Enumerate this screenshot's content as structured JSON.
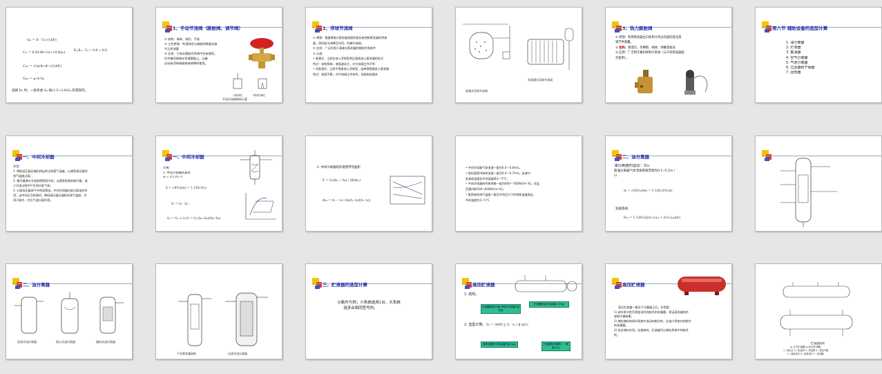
{
  "slides": [
    {
      "id": 1,
      "formulas": [
        "G₀ = d · C₀·√(ΔP)",
        "C₀ = 0.0148·√(v₁+0.6γ₂)",
        "K₁,K₂ : C₀ = 0.6 ~ 0.8",
        "C₀₂ = √(π/4)·d²·√(2ΔP)",
        "G₀₀ = μ·A·G₀"
      ],
      "note": "选择 D₀ 时，一般考虑 G₀ 按(1.5~2.0)G₀ 的范围内。"
    },
    {
      "id": 2,
      "title": "1、手动节流阀（膨胀阀、调节阀）",
      "lines": [
        "① 结构：阀体、阀芯、手轮",
        "② 工作原理：利用阀芯与阀座间隙变化调",
        "   节工质流量",
        "③ 应用：只有在氨制冷系统中仍有使用，",
        "   作为备用阀装在旁通管路上，以备",
        "   自动或浮球阀维修或故障时使用。"
      ],
      "caption": "手动节流阀结构示意",
      "sub_captions": [
        "针形阀芯",
        "V形缺口阀芯"
      ]
    },
    {
      "id": 3,
      "title": "2、浮球节流阀",
      "lines": [
        "① 原理：根据满液式蒸发器液面的变化来控制蒸发器的供液",
        "   量，同时起节流降压作用，叫做节流阀。",
        "② 应用：广泛应用于满液式蒸发器的氨制冷系统中",
        "③ 分类：",
        "• 直通式：工质先进入浮球室然后直接进入蒸发器的形式",
        "   特点：结构简单，液面波动大，对节流阀工作不利",
        "• 非直通式：工质不直接进入浮球室，由单独管路进入蒸发器",
        "   特点：液面平稳，对节流阀工作有利，但结构较复杂"
      ]
    },
    {
      "id": 4,
      "captions": [
        "直通式浮球节流阀",
        "非直通式浮球节流阀"
      ]
    },
    {
      "id": 5,
      "title": "3、热力膨胀阀",
      "lines": [
        "① 原理：利用蒸发器出口处制冷剂过热度的变化来",
        "   调节供液量。"
      ],
      "structure_label": "结构：",
      "structure_text": "感温包、毛细管、阀体、弹簧等组成",
      "lines2": [
        "③ 应用：广泛用于氟利昂制冷系统（与干式蒸发器配",
        "   合使用）。"
      ]
    },
    {
      "id": 6,
      "title": "第六节 辅助设备的选型计算",
      "items": [
        "1. 油分离器",
        "2. 贮液器",
        "3. 集油器",
        "4. 空气分离器",
        "5. 气液分离器",
        "6. 过滤器和干燥器",
        "7. 回热器"
      ]
    },
    {
      "id": 7,
      "title": "一、中间冷却器",
      "lines": [
        "作用：",
        "1. 降低低压级压缩机排出的过热蒸气温度，以避免高压级的",
        "   排气温度过高；",
        "2. 使冷凝液在节流前得到再冷却，以提高系统的制冷量，减",
        "   少节流过程中产生的闪发气体；",
        "3. 分离低压级排气中的润滑油，中间冷却器还起分离油的作",
        "   用。当中间压力较高时，降低高压级压缩机的排气温度，并",
        "   用于制冷、并且气液分离作用。"
      ]
    },
    {
      "id": 8,
      "title": "一、中间冷却器",
      "lines": [
        "计算：",
        "1. 中间冷却器的直径",
        "   w = 0.5 m / s"
      ],
      "formulas": [
        "d = √(4V₃/πw) = 1.128√(V₃)",
        "Gᵢ = G₂ · h/...",
        "G₂ = G₁ + Gᵢ      Gᵢ = G₁·(h₅−h₆)/(h₃−h₆)"
      ]
    },
    {
      "id": 9,
      "title": "2. 中间冷却器蛇形盘管传热面积",
      "formulas": [
        "F = G₁(h₅ − h₆) / (KΔtₘ)",
        "Δtₘ = (t₁ − t₂) / ln((t₁−t₀)/(t₂−t₀))"
      ]
    },
    {
      "id": 10,
      "lines": [
        "• 中间冷却器气体流速一般为0.5—0.8m/s。",
        "• 蛇形盘管中液体流速一般为0.4—0.7m/s。出液口",
        "   处液体温度比中间温度高3—5°C。",
        "• 中间冷却器的传热系数一般为600—700W/(m²·K)，在此",
        "   范围内取500~600W/(m²·K)；",
        "• 氨系统的排气温度一般及中间压力下的饱和温度高出",
        "   中间温度约3—5°C"
      ]
    },
    {
      "id": 11,
      "title": "二、油分离器",
      "lines": [
        "油分离器的直径：D₂₂",
        "氨油分离器气体流速取值范围为0.1~0.2m /",
        "   s)"
      ],
      "formulas": [
        "d₂ = √(4λVₐ/πw) = 1.128√(λVₐ/w)",
        "D₂₂ = 1.128√(λ[(G·v₂)ₐₐ + (G·v₂)ₐₐ]/w)"
      ],
      "label": "双级系统"
    },
    {
      "id": 12
    },
    {
      "id": 13,
      "title": "二、油分离器",
      "captions": [
        "洗涤式油分离器",
        "离心式油分离器",
        "填料式油分离器"
      ]
    },
    {
      "id": 14,
      "captions": [
        "干式蒸发器结构",
        "过滤式油分离器"
      ]
    },
    {
      "id": 15,
      "title": "三、贮液器的选型计算",
      "lines": [
        "以氨作为例，小系统选用1台，大系统",
        "选多台相同型号的。"
      ]
    },
    {
      "id": 16,
      "title": "高压贮液器",
      "lines": [
        "1. 结构。",
        "2. 选型计算。"
      ],
      "formula": "V₀ = 3600 ∑ G · v₁ / β (m³)",
      "boxes": [
        "贮液器容积与每小时制冷剂循环量有关",
        "贮液器的设计容纳量 m³/kg",
        "各蒸发器的冷却水循环量 kg/s",
        "贮液器的充满率，一般取70%"
      ]
    },
    {
      "id": 17,
      "title": "高压贮液器",
      "lines": [
        "高压贮液器一般位于冷凝器之后。作用是：",
        "",
        "1) 调节季节性负荷变化时的制冷剂充灌量，保证蒸发器的供",
        "   液和冷凝效果。",
        "2) 储存储存和调节系统中流动的制冷剂，比减少系统内的制冷",
        "   剂充灌量。",
        "3) 安全储存作用。在维修时，贮液器可以储存系统中的制冷",
        "   剂。"
      ]
    },
    {
      "id": 18,
      "caption_title": "贮液器结构",
      "captions": [
        "a) 立式贮液器      b) 卧式贮液器",
        "1—液位计 2—安全阀 3—均压管 4—放空气管",
        "5—液体出口 6—液体进口 7—放油管"
      ]
    }
  ],
  "colors": {
    "title": "#1f2fa8",
    "accent_red": "#d10000",
    "box_green": "#2fbf8f",
    "background": "#e6e6e6"
  }
}
